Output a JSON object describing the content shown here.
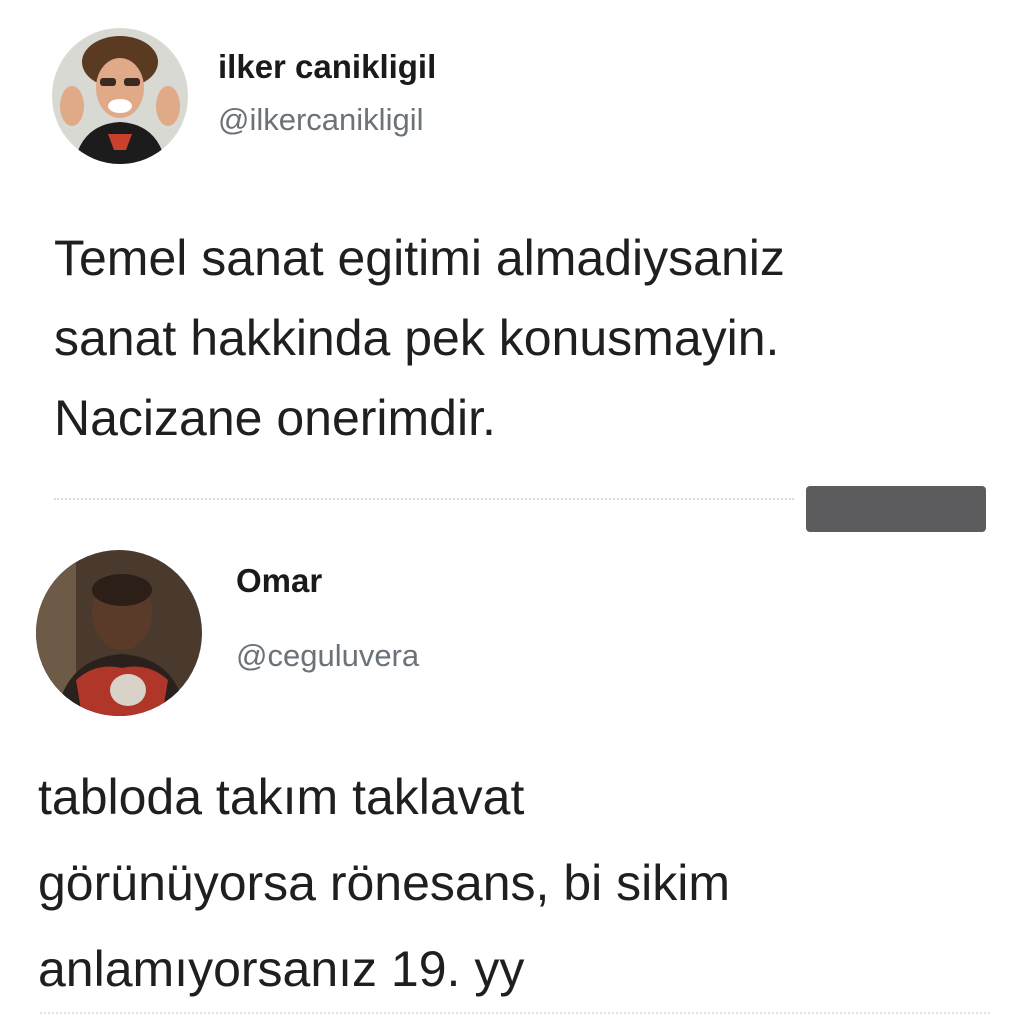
{
  "tweets": [
    {
      "display_name": "ilker canikligil",
      "handle": "@ilkercanikligil",
      "text_lines": [
        "Temel sanat egitimi almadiysaniz",
        "sanat hakkinda pek konusmayin.",
        "Nacizane onerimdir."
      ]
    },
    {
      "display_name": "Omar",
      "handle": "@ceguluvera",
      "text_lines": [
        "tabloda takım taklavat",
        "görünüyorsa rönesans, bi sikim",
        "anlamıyorsanız 19. yy"
      ]
    }
  ],
  "colors": {
    "name": "#1a1a1a",
    "handle": "#6b7278",
    "text": "#1f1f1f",
    "redaction": "#5c5c5f"
  },
  "icons": {
    "avatar_1": "man-smiling-avatar",
    "avatar_2": "man-portrait-avatar"
  }
}
